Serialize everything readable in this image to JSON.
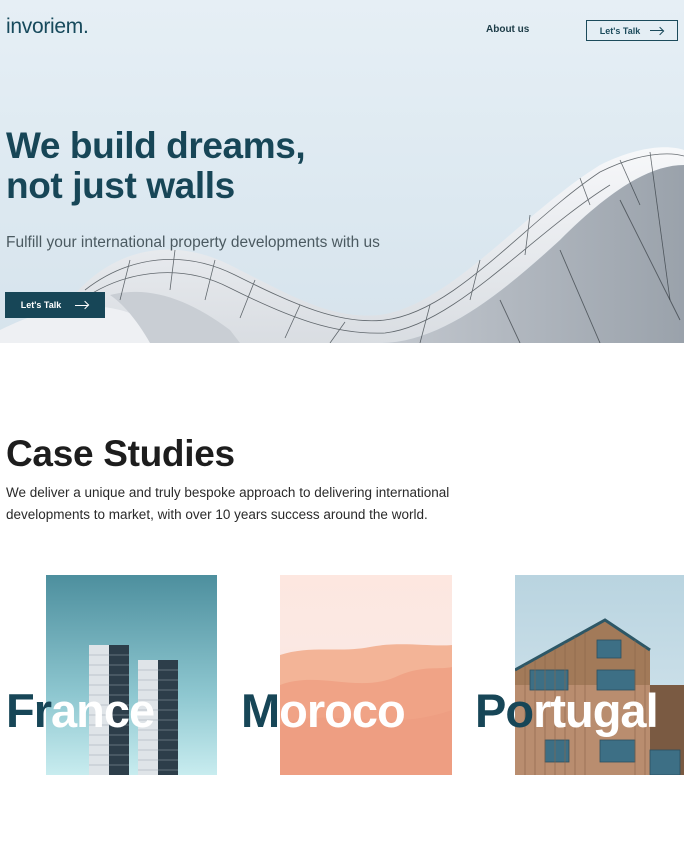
{
  "brand": {
    "logo_text": "invoriem",
    "logo_dot": ".",
    "color": "#174a5c"
  },
  "nav": {
    "about_label": "About us",
    "cta_label": "Let's Talk",
    "cta_icon": "arrow-right-icon"
  },
  "hero": {
    "headline_line1": "We build dreams,",
    "headline_line2": "not just walls",
    "subline": "Fulfill your international property developments with us",
    "cta_label": "Let's Talk",
    "cta_icon": "arrow-right-icon"
  },
  "case_studies": {
    "title": "Case Studies",
    "description": "We deliver a unique and truly bespoke approach to delivering international developments to market, with over 10 years success around the world.",
    "cards": [
      {
        "label_dark": "Fr",
        "label_light": "ance",
        "image": "towers-teal"
      },
      {
        "label_dark": "M",
        "label_light": "oroco",
        "image": "desert-dunes"
      },
      {
        "label_dark": "Po",
        "label_light": "rtugal",
        "image": "wooden-house"
      }
    ]
  },
  "colors": {
    "primary": "#174657",
    "dark_text": "#1d1d1d",
    "white": "#ffffff"
  }
}
